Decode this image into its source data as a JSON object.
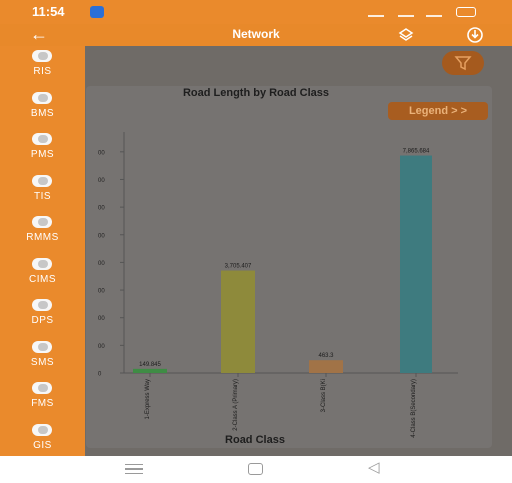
{
  "status_bar": {
    "time": "11:54",
    "battery": "100"
  },
  "app_bar": {
    "back_icon": "←",
    "title": "Network"
  },
  "drawer": {
    "items": [
      {
        "label": "RIS"
      },
      {
        "label": "BMS"
      },
      {
        "label": "PMS"
      },
      {
        "label": "TIS"
      },
      {
        "label": "RMMS"
      },
      {
        "label": "CIMS"
      },
      {
        "label": "DPS"
      },
      {
        "label": "SMS"
      },
      {
        "label": "FMS"
      },
      {
        "label": "GIS"
      }
    ]
  },
  "legend_button": "Legend > >",
  "chart_data": {
    "type": "bar",
    "title": "Road Length by Road Class",
    "xlabel": "Road Class",
    "ylabel": "",
    "ylim": [
      0,
      8500
    ],
    "y_ticks": [
      "0",
      "00",
      "00",
      "00",
      "00",
      "00",
      "00",
      "00",
      "00"
    ],
    "y_tick_values": [
      0,
      1000,
      2000,
      3000,
      4000,
      5000,
      6000,
      7000,
      8000
    ],
    "categories": [
      "1-Express Way",
      "2-Class A (Primary)",
      "3-Class B(Ki",
      "4-Class B(Secondary)"
    ],
    "values": [
      149.845,
      3705.407,
      463.3,
      7865.684
    ],
    "value_labels": [
      "149.845",
      "3,705.407",
      "463.3",
      "7,865.684"
    ],
    "colors": [
      "#3f8c45",
      "#8e8a3b",
      "#a17347",
      "#3e7b7f"
    ],
    "grid": false,
    "legend": "hidden"
  },
  "colors": {
    "primary": "#e8892a",
    "overlay": "#6f6b67",
    "legend_button": "#a85d20"
  },
  "nav_bar": {
    "back_icon": "◁"
  }
}
